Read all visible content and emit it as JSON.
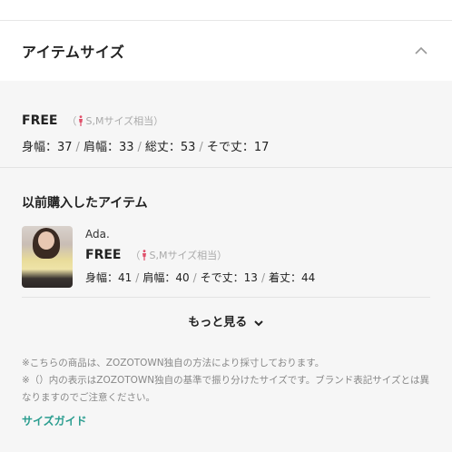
{
  "header": {
    "title": "アイテムサイズ"
  },
  "size": {
    "label": "FREE",
    "note_open": "（",
    "note_text": "S,Mサイズ相当）",
    "measurements": [
      "身幅：37",
      "肩幅：33",
      "総丈：53",
      "そで丈：17"
    ]
  },
  "previous": {
    "title": "以前購入したアイテム",
    "brand": "Ada.",
    "label": "FREE",
    "note_open": "（",
    "note_text": "S,Mサイズ相当）",
    "measurements": [
      "身幅：41",
      "肩幅：40",
      "そで丈：13",
      "着丈：44"
    ]
  },
  "more_label": "もっと見る",
  "notes": [
    "※こちらの商品は、ZOZOTOWN独自の方法により採寸しております。",
    "※（）内の表示はZOZOTOWN独自の基準で振り分けたサイズです。ブランド表記サイズとは異なりますのでご注意ください。"
  ],
  "guide_link": "サイズガイド",
  "colors": {
    "accent": "#2a9d8f",
    "figure": "#e0506a"
  },
  "icons": {
    "collapse": "chevron-up-icon",
    "more": "chevron-down-icon",
    "figure": "person-figure-icon"
  }
}
